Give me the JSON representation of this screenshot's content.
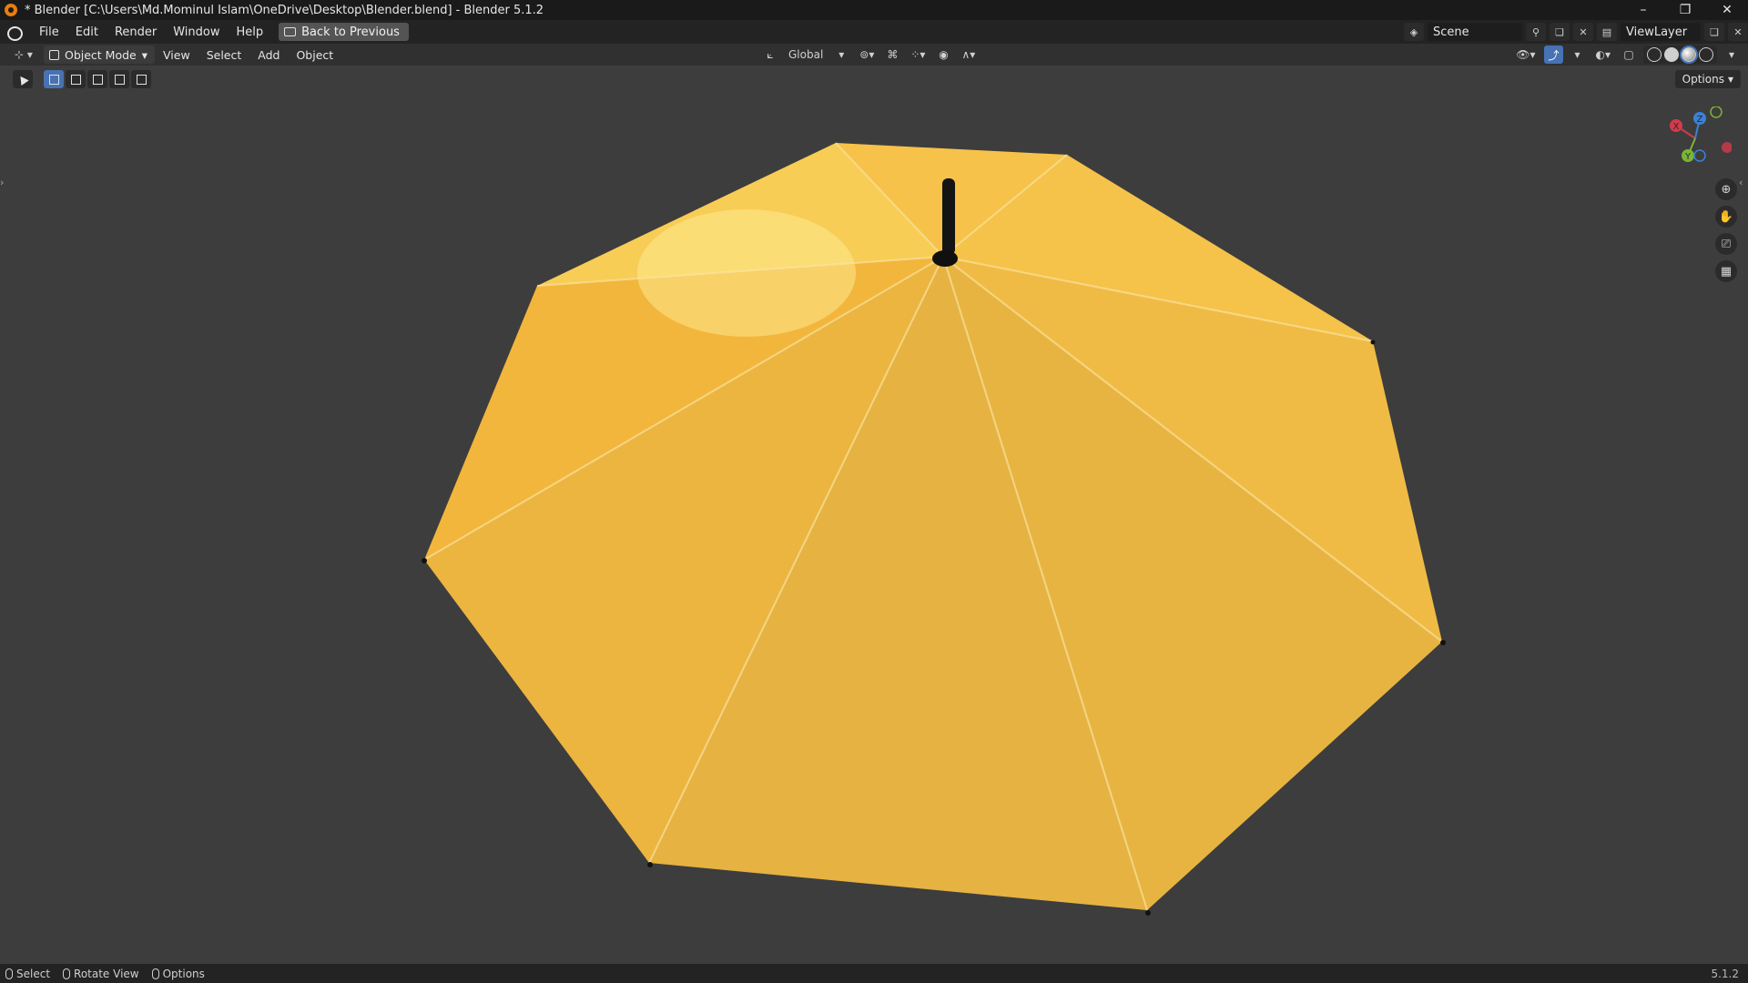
{
  "titlebar": {
    "title": "* Blender [C:\\Users\\Md.Mominul Islam\\OneDrive\\Desktop\\Blender.blend] - Blender 5.1.2",
    "minimize": "–",
    "maximize": "❐",
    "close": "✕"
  },
  "menubar": {
    "items": [
      "File",
      "Edit",
      "Render",
      "Window",
      "Help"
    ],
    "back_button": "Back to Previous",
    "scene": "Scene",
    "view_layer": "ViewLayer"
  },
  "header": {
    "mode": "Object Mode",
    "menus": [
      "View",
      "Select",
      "Add",
      "Object"
    ],
    "transform_orientation": "Global"
  },
  "toolbar": {
    "options": "Options"
  },
  "gizmo": {
    "x_label": "X",
    "y_label": "Y",
    "z_label": "Z",
    "x_color": "#d33a4a",
    "y_color": "#7bb535",
    "z_color": "#3b82d6"
  },
  "statusbar": {
    "select": "Select",
    "rotate": "Rotate View",
    "options": "Options",
    "version": "5.1.2"
  },
  "scene_object": {
    "name": "umbrella",
    "canopy_color": "#f1b53a",
    "handle_color": "#151515"
  }
}
